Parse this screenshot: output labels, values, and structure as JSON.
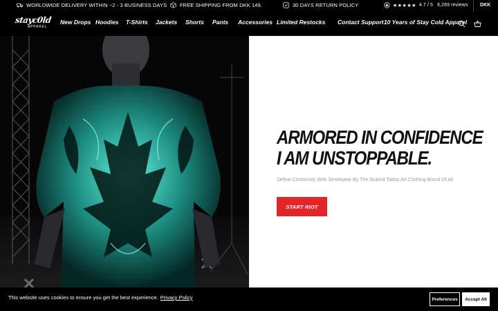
{
  "topbar": {
    "delivery": "WORLDWIDE DELIVERY WITHIN ~2 - 3 BUSINESS DAYS",
    "shipping": "FREE SHIPPING FROM DKK 149.",
    "returns": "30 DAYS RETURN POLICY",
    "stars": "★★★★★",
    "rating": "4.7 / 5",
    "reviews": "6,269 reviews",
    "currency": "DKK"
  },
  "header": {
    "logo_line1": "stayc0ld",
    "logo_line2": "APPAREL",
    "nav": [
      "New Drops",
      "Hoodies",
      "T-Shirts",
      "Jackets",
      "Shorts",
      "Pants",
      "Accessories",
      "Limited Restocks",
      "Contact Support",
      "10 Years of Stay Cold Apparel"
    ]
  },
  "hero": {
    "headline_line1": "ARMORED IN CONFIDENCE",
    "headline_line2": "I AM UNSTOPPABLE.",
    "subtext": "Defeat Conformity With Streetwear By The Sickest Tattoo Art Clothing Brand Of All.",
    "cta": "START RIOT"
  },
  "cookie": {
    "text": "This website uses cookies to ensure you get the best experience.",
    "link": "Privacy Policy",
    "preferences": "Preferences",
    "accept": "Accept All"
  },
  "colors": {
    "accent": "#e4262b",
    "shirt_glow": "#3fd6c3",
    "background": "#000000"
  },
  "icons": [
    "truck-icon",
    "box-icon",
    "return-icon",
    "review-badge-icon",
    "search-icon",
    "basket-icon"
  ]
}
